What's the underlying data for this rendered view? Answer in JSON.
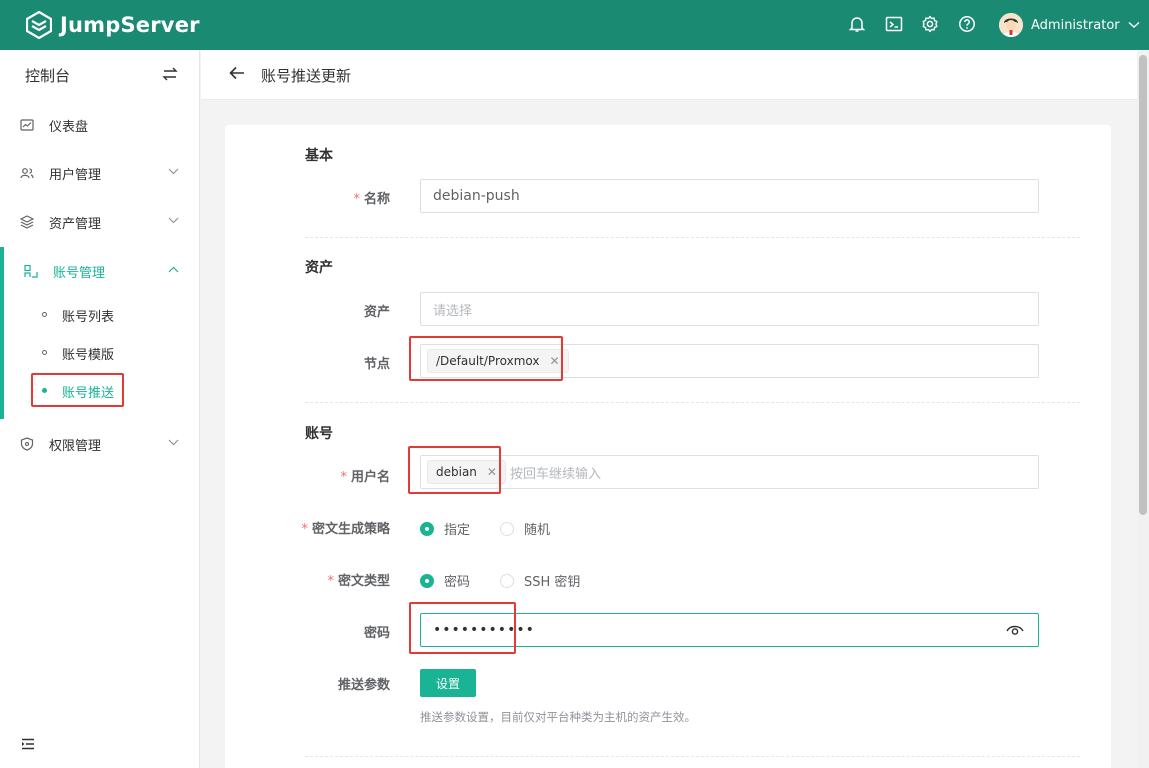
{
  "brand": {
    "name": "JumpServer"
  },
  "topbar": {
    "icons": [
      "bell-icon",
      "terminal-icon",
      "gear-icon",
      "help-icon"
    ],
    "user_name": "Administrator"
  },
  "sidebar": {
    "title": "控制台",
    "items": [
      {
        "label": "仪表盘",
        "icon": "dashboard-icon"
      },
      {
        "label": "用户管理",
        "icon": "users-icon"
      },
      {
        "label": "资产管理",
        "icon": "assets-icon"
      },
      {
        "label": "账号管理",
        "icon": "accounts-icon"
      },
      {
        "label": "权限管理",
        "icon": "shield-icon"
      }
    ],
    "sub_items": [
      {
        "label": "账号列表"
      },
      {
        "label": "账号模版"
      },
      {
        "label": "账号推送"
      }
    ]
  },
  "page": {
    "title": "账号推送更新"
  },
  "form": {
    "sections": {
      "basic": "基本",
      "asset": "资产",
      "account": "账号"
    },
    "name": {
      "label": "名称",
      "value": "debian-push"
    },
    "assets": {
      "label": "资产",
      "placeholder": "请选择"
    },
    "nodes": {
      "label": "节点",
      "tag": "/Default/Proxmox"
    },
    "username": {
      "label": "用户名",
      "tag": "debian",
      "placeholder": "按回车继续输入"
    },
    "secret_strategy": {
      "label": "密文生成策略",
      "options": [
        "指定",
        "随机"
      ],
      "selected": "指定"
    },
    "secret_type": {
      "label": "密文类型",
      "options": [
        "密码",
        "SSH 密钥"
      ],
      "selected": "密码"
    },
    "password": {
      "label": "密码",
      "value": "•••••••••••"
    },
    "push_params": {
      "label": "推送参数",
      "button": "设置",
      "help": "推送参数设置，目前仅对平台种类为主机的资产生效。"
    }
  },
  "colors": {
    "brand": "#1a8a73",
    "accent": "#1ab394",
    "required": "#f56c6c",
    "highlight": "#e53935"
  }
}
